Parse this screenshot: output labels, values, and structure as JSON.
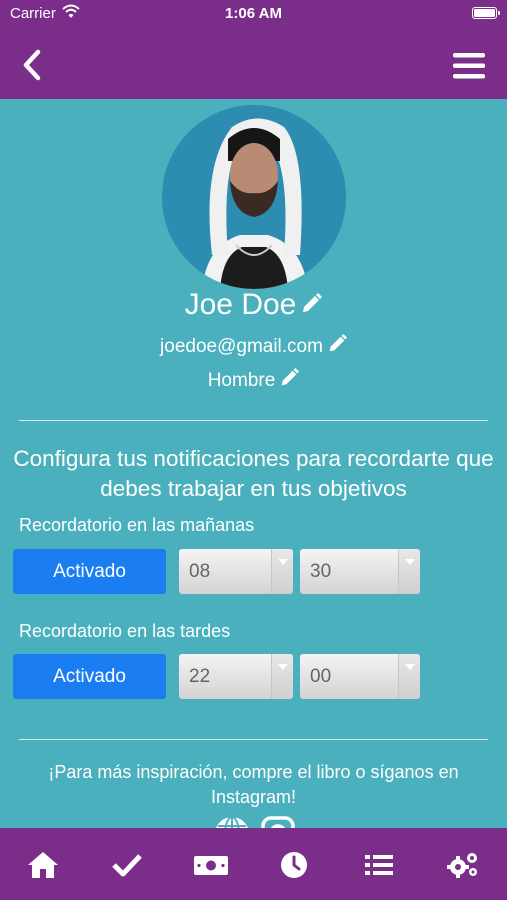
{
  "status_bar": {
    "carrier": "Carrier",
    "time": "1:06 AM"
  },
  "profile": {
    "name": "Joe Doe",
    "email": "joedoe@gmail.com",
    "gender": "Hombre"
  },
  "notifications": {
    "headline": "Configura tus notificaciones para recordarte que debes trabajar en tus objetivos",
    "morning": {
      "label": "Recordatorio en las mañanas",
      "toggle": "Activado",
      "hour": "08",
      "minute": "30"
    },
    "evening": {
      "label": "Recordatorio en las tardes",
      "toggle": "Activado",
      "hour": "22",
      "minute": "00"
    }
  },
  "promo_text": "¡Para más inspiración, compre el libro o síganos en Instagram!",
  "icons": {
    "back": "chevron-left-icon",
    "menu": "hamburger-icon",
    "edit": "pencil-icon",
    "tabs": [
      "home-icon",
      "check-icon",
      "money-icon",
      "clock-icon",
      "list-icon",
      "gears-icon"
    ],
    "social": [
      "globe-icon",
      "instagram-icon"
    ]
  },
  "colors": {
    "header": "#7a2e8a",
    "background": "#4ab0bd",
    "accent": "#1a7ef2"
  }
}
